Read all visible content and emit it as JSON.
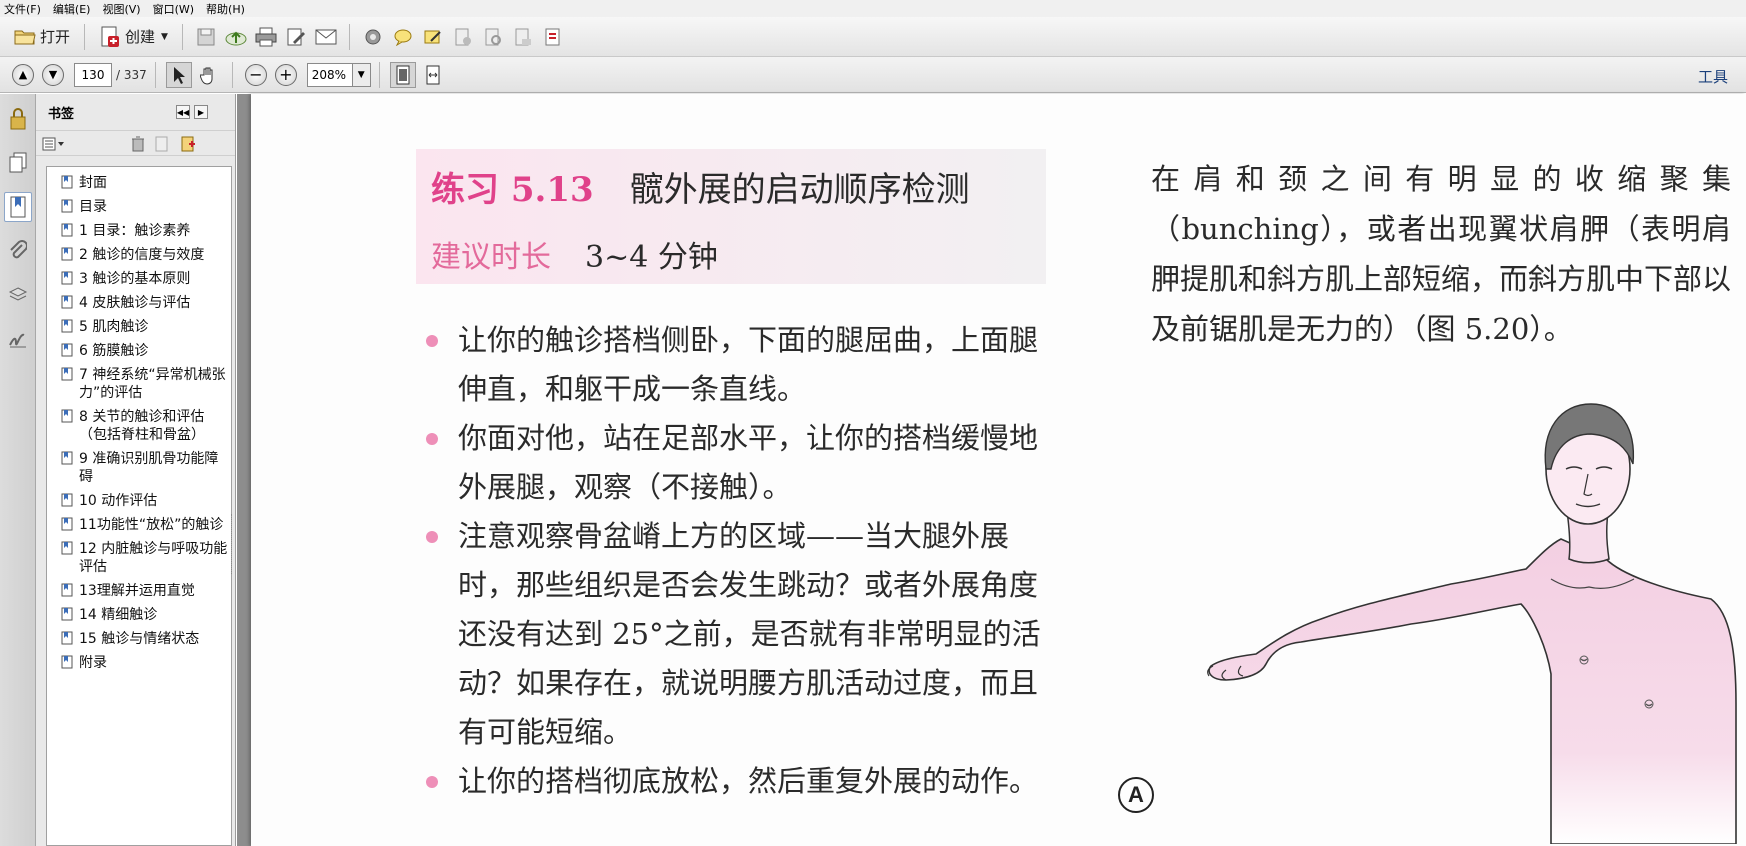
{
  "menu": [
    "文件(F)",
    "编辑(E)",
    "视图(V)",
    "窗口(W)",
    "帮助(H)"
  ],
  "toolbar": {
    "open_label": "打开",
    "create_label": "创建",
    "tools_label": "工具"
  },
  "nav": {
    "current_page": "130",
    "total_pages": "/ 337",
    "zoom": "208%"
  },
  "bookmarks": {
    "title": "书签",
    "items": [
      "封面",
      "目录",
      "1 目录：触诊素养",
      "2 触诊的信度与效度",
      "3 触诊的基本原则",
      "4 皮肤触诊与评估",
      "5 肌肉触诊",
      "6 筋膜触诊",
      "7 神经系统“异常机械张力”的评估",
      "8 关节的触诊和评估（包括脊柱和骨盆）",
      "9 准确识别肌骨功能障碍",
      "10 动作评估",
      "11功能性“放松”的触诊",
      "12 内脏触诊与呼吸功能评估",
      "13理解并运用直觉",
      "14 精细触诊",
      "15 触诊与情绪状态",
      "附录"
    ]
  },
  "document": {
    "exercise_number": "练习 5.13",
    "exercise_title": "髋外展的启动顺序检测",
    "duration_label": "建议时长",
    "duration_value": "3~4 分钟",
    "bullets": [
      "让你的触诊搭档侧卧，下面的腿屈曲，上面腿伸直，和躯干成一条直线。",
      "你面对他，站在足部水平，让你的搭档缓慢地外展腿，观察（不接触）。",
      "注意观察骨盆嵴上方的区域——当大腿外展时，那些组织是否会发生跳动？或者外展角度还没有达到 25°之前，是否就有非常明显的活动？如果存在，就说明腰方肌活动过度，而且有可能短缩。",
      "让你的搭档彻底放松，然后重复外展的动作。"
    ],
    "right_text": "在肩和颈之间有明显的收缩聚集（bunching），或者出现翼状肩胛（表明肩胛提肌和斜方肌上部短缩，而斜方肌中下部以及前锯肌是无力的）（图 5.20）。",
    "figure_label": "A"
  },
  "colors": {
    "accent_pink": "#e0428a",
    "bullet_pink": "#ee8fb8",
    "figure_skin": "#f7dcea"
  }
}
